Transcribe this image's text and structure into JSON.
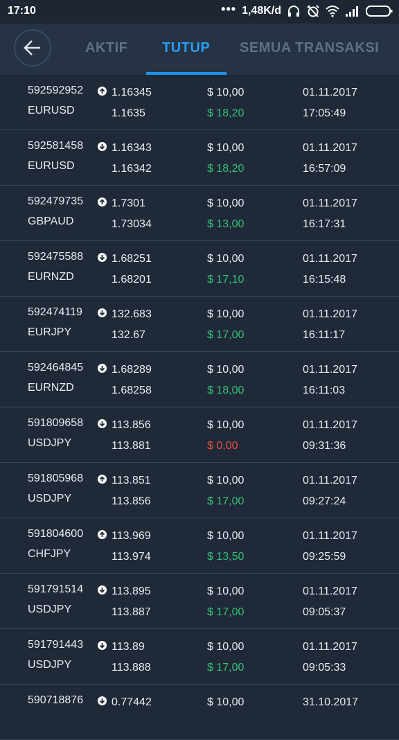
{
  "status_bar": {
    "time": "17:10",
    "network_speed": "1,48K/d",
    "icons": [
      "more-dots-icon",
      "headphones-icon",
      "alarm-off-icon",
      "wifi-icon",
      "signal-icon",
      "battery-icon"
    ]
  },
  "header": {
    "back_icon": "arrow-left-icon",
    "tabs": [
      {
        "label": "AKTIF",
        "active": false
      },
      {
        "label": "TUTUP",
        "active": true
      },
      {
        "label": "SEMUA TRANSAKSI",
        "active": false
      }
    ]
  },
  "colors": {
    "accent": "#1e93ec",
    "profit": "#36c17a",
    "loss": "#e9513d",
    "background": "#1f2937"
  },
  "trades": [
    {
      "id": "592592952",
      "symbol": "EURUSD",
      "direction": "up",
      "open_price": "1.16345",
      "close_price": "1.1635",
      "amount": "$ 10,00",
      "payout": "$ 18,20",
      "payout_type": "profit",
      "date": "01.11.2017",
      "time": "17:05:49"
    },
    {
      "id": "592581458",
      "symbol": "EURUSD",
      "direction": "down",
      "open_price": "1.16343",
      "close_price": "1.16342",
      "amount": "$ 10,00",
      "payout": "$ 18,20",
      "payout_type": "profit",
      "date": "01.11.2017",
      "time": "16:57:09"
    },
    {
      "id": "592479735",
      "symbol": "GBPAUD",
      "direction": "up",
      "open_price": "1.7301",
      "close_price": "1.73034",
      "amount": "$ 10,00",
      "payout": "$ 13,00",
      "payout_type": "profit",
      "date": "01.11.2017",
      "time": "16:17:31"
    },
    {
      "id": "592475588",
      "symbol": "EURNZD",
      "direction": "down",
      "open_price": "1.68251",
      "close_price": "1.68201",
      "amount": "$ 10,00",
      "payout": "$ 17,10",
      "payout_type": "profit",
      "date": "01.11.2017",
      "time": "16:15:48"
    },
    {
      "id": "592474119",
      "symbol": "EURJPY",
      "direction": "down",
      "open_price": "132.683",
      "close_price": "132.67",
      "amount": "$ 10,00",
      "payout": "$ 17,00",
      "payout_type": "profit",
      "date": "01.11.2017",
      "time": "16:11:17"
    },
    {
      "id": "592464845",
      "symbol": "EURNZD",
      "direction": "down",
      "open_price": "1.68289",
      "close_price": "1.68258",
      "amount": "$ 10,00",
      "payout": "$ 18,00",
      "payout_type": "profit",
      "date": "01.11.2017",
      "time": "16:11:03"
    },
    {
      "id": "591809658",
      "symbol": "USDJPY",
      "direction": "down",
      "open_price": "113.856",
      "close_price": "113.881",
      "amount": "$ 10,00",
      "payout": "$ 0,00",
      "payout_type": "loss",
      "date": "01.11.2017",
      "time": "09:31:36"
    },
    {
      "id": "591805968",
      "symbol": "USDJPY",
      "direction": "up",
      "open_price": "113.851",
      "close_price": "113.856",
      "amount": "$ 10,00",
      "payout": "$ 17,00",
      "payout_type": "profit",
      "date": "01.11.2017",
      "time": "09:27:24"
    },
    {
      "id": "591804600",
      "symbol": "CHFJPY",
      "direction": "up",
      "open_price": "113.969",
      "close_price": "113.974",
      "amount": "$ 10,00",
      "payout": "$ 13,50",
      "payout_type": "profit",
      "date": "01.11.2017",
      "time": "09:25:59"
    },
    {
      "id": "591791514",
      "symbol": "USDJPY",
      "direction": "down",
      "open_price": "113.895",
      "close_price": "113.887",
      "amount": "$ 10,00",
      "payout": "$ 17,00",
      "payout_type": "profit",
      "date": "01.11.2017",
      "time": "09:05:37"
    },
    {
      "id": "591791443",
      "symbol": "USDJPY",
      "direction": "down",
      "open_price": "113.89",
      "close_price": "113.888",
      "amount": "$ 10,00",
      "payout": "$ 17,00",
      "payout_type": "profit",
      "date": "01.11.2017",
      "time": "09:05:33"
    },
    {
      "id": "590718876",
      "symbol": "",
      "direction": "down",
      "open_price": "0.77442",
      "close_price": "",
      "amount": "$ 10,00",
      "payout": "",
      "payout_type": "profit",
      "date": "31.10.2017",
      "time": ""
    }
  ]
}
